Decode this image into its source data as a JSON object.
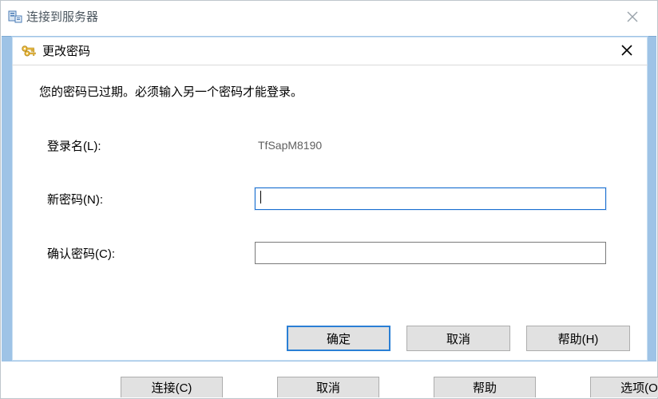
{
  "outerWindow": {
    "title": "连接到服务器",
    "closeName": "close-icon"
  },
  "dialog": {
    "title": "更改密码",
    "message": "您的密码已过期。必须输入另一个密码才能登录。",
    "fields": {
      "login": {
        "label": "登录名(L):",
        "value": "TfSapM8190"
      },
      "newPassword": {
        "label": "新密码(N):",
        "value": ""
      },
      "confirmPassword": {
        "label": "确认密码(C):",
        "value": ""
      }
    },
    "buttons": {
      "ok": "确定",
      "cancel": "取消",
      "help": "帮助(H)"
    }
  },
  "backgroundButtons": {
    "connect": "连接(C)",
    "cancel": "取消",
    "help": "帮助",
    "options": "选项(O)"
  }
}
